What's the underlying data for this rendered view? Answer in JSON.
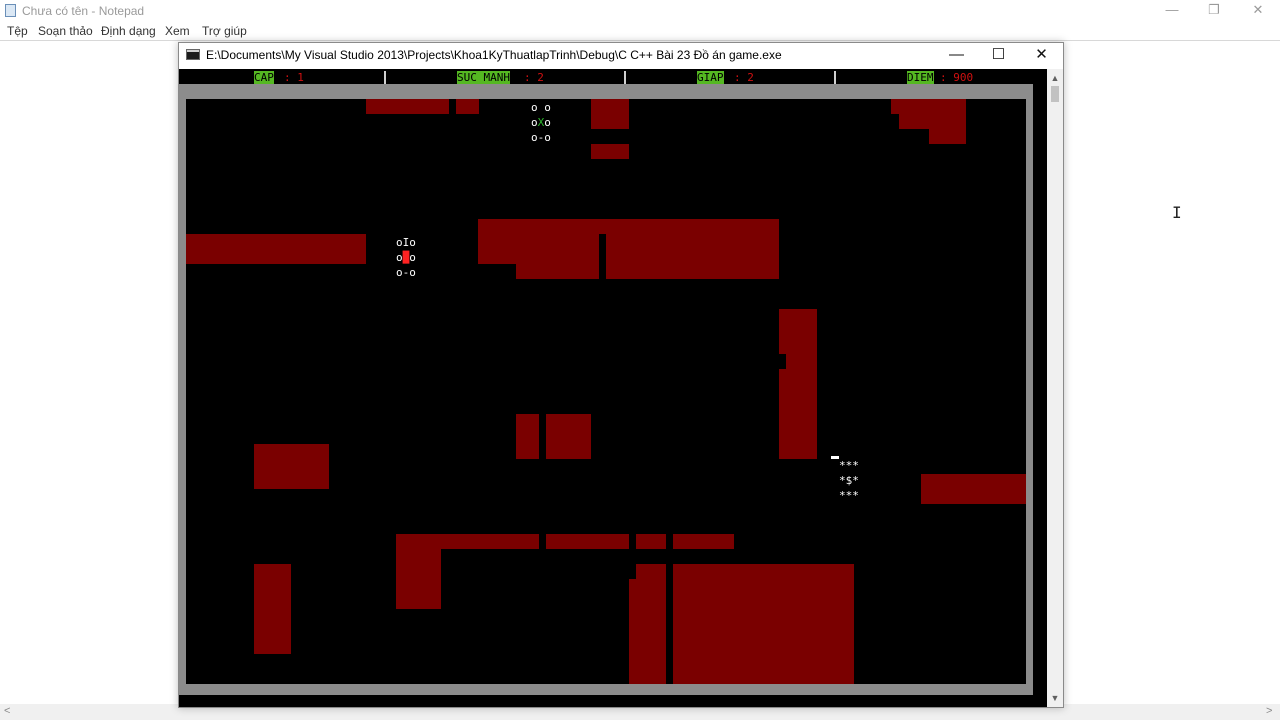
{
  "notepad": {
    "title": "Chưa có tên - Notepad",
    "menu": [
      "Tệp",
      "Soạn thảo",
      "Định dạng",
      "Xem",
      "Trợ giúp"
    ],
    "controls": {
      "minimize": "—",
      "restore": "❐",
      "close": "✕"
    },
    "scroll_left": "<",
    "scroll_right": ">"
  },
  "console": {
    "title": "E:\\Documents\\My Visual Studio 2013\\Projects\\Khoa1KyThuatlapTrinh\\Debug\\C C++ Bài 23 Đồ án game.exe",
    "controls": {
      "minimize": "—",
      "maximize": "☐",
      "close": "✕"
    },
    "scroll_up": "▲",
    "scroll_down": "▼"
  },
  "status": {
    "level_label": "CAP",
    "level_value": ": 1",
    "power_label": "SUC MANH",
    "power_value": ": 2",
    "armor_label": "GIAP",
    "armor_value": ": 2",
    "score_label": "DIEM",
    "score_value": ": 900",
    "colors": {
      "label_bg": "#55b822",
      "value": "#d01010"
    }
  },
  "sprites": {
    "enemy_top": {
      "line1": "o o",
      "line2_a": "o",
      "line2_core": "X",
      "line2_b": "o",
      "line3": "o-o"
    },
    "enemy_left": {
      "line1": "oIo",
      "line2_a": "o",
      "line2_core": "█",
      "line2_b": "o",
      "line3": "o-o"
    },
    "player": {
      "line1": "***",
      "line2": "*$*",
      "line3": "***"
    }
  },
  "colors": {
    "wall": "#7a0000",
    "frame": "#8c8c8c",
    "background": "#000000"
  }
}
